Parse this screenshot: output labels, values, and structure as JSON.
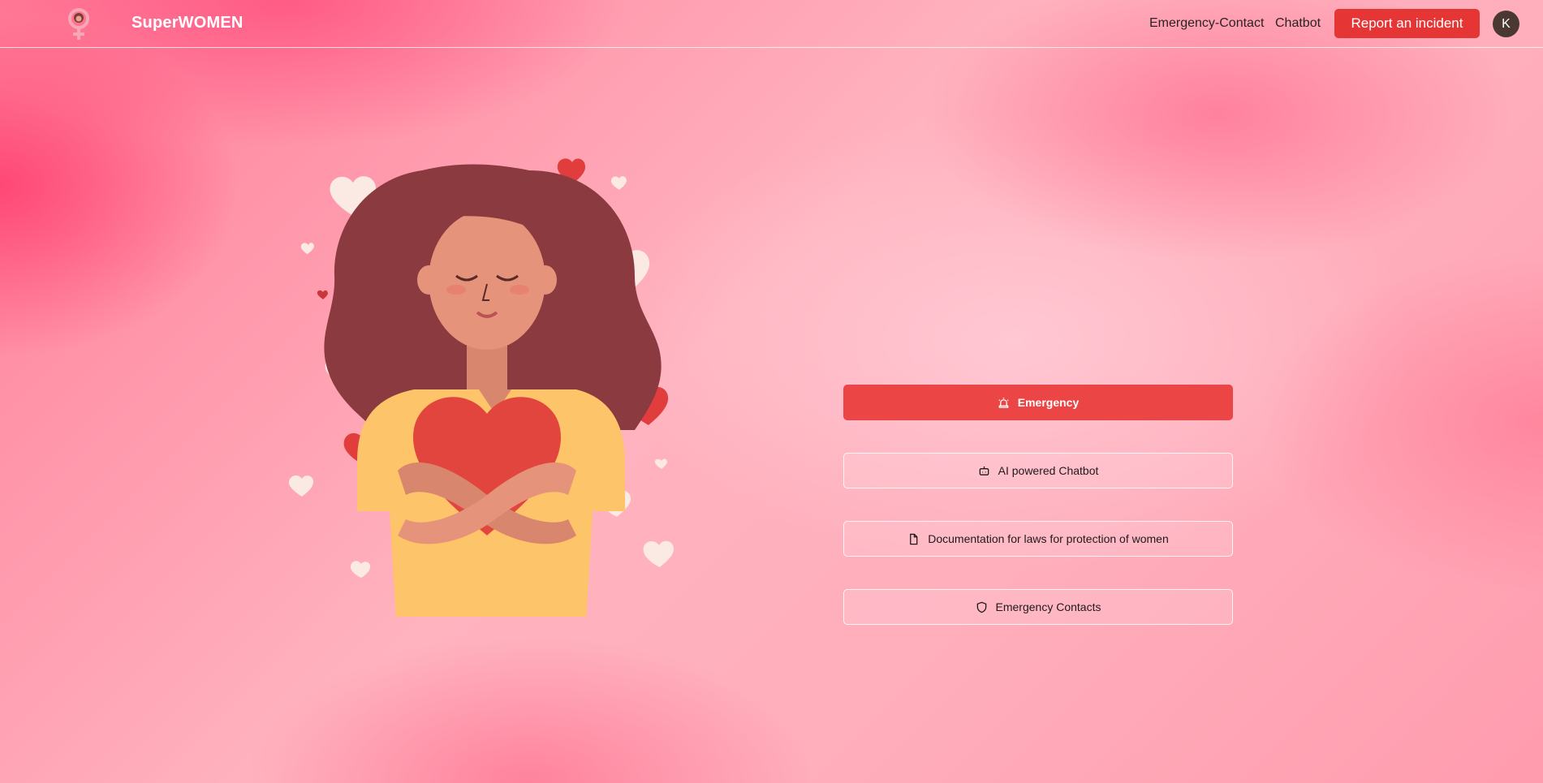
{
  "brand": {
    "name": "SuperWOMEN",
    "logo_icon": "female-symbol-icon"
  },
  "nav": {
    "links": [
      {
        "label": "Emergency-Contact"
      },
      {
        "label": "Chatbot"
      }
    ],
    "report_button": "Report an incident",
    "avatar_initial": "K"
  },
  "actions": [
    {
      "label": "Emergency",
      "icon": "siren-icon",
      "style": "primary"
    },
    {
      "label": "AI powered Chatbot",
      "icon": "bot-icon",
      "style": "outline"
    },
    {
      "label": "Documentation for laws for protection of women",
      "icon": "file-icon",
      "style": "outline"
    },
    {
      "label": "Emergency Contacts",
      "icon": "shield-icon",
      "style": "outline"
    }
  ],
  "colors": {
    "accent": "#e53535",
    "primary_action": "#ec4545",
    "brand_text": "#ffffff",
    "avatar_bg": "#4a3833"
  },
  "illustration": {
    "subject": "woman-hugging-heart"
  }
}
